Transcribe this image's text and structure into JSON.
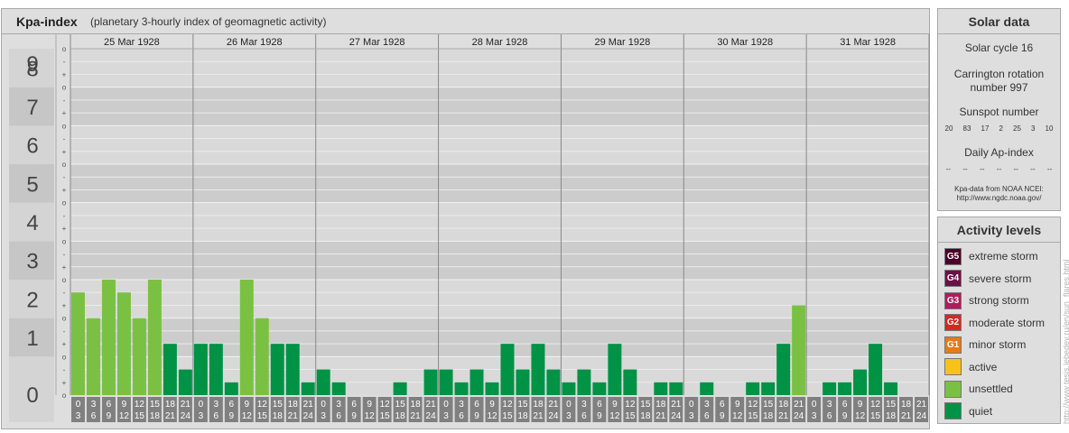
{
  "header": {
    "title": "Kpa-index",
    "subtitle": "(planetary 3-hourly index of geomagnetic activity)"
  },
  "chart_data": {
    "type": "bar",
    "title": "Kpa-index",
    "subtitle": "(planetary 3-hourly index of geomagnetic activity)",
    "ylim": [
      0,
      9
    ],
    "y_ticks": [
      "0",
      "1",
      "2",
      "3",
      "4",
      "5",
      "6",
      "7",
      "8",
      "9"
    ],
    "y_subticks": [
      "o",
      "+",
      "-"
    ],
    "days": [
      "25 Mar 1928",
      "26 Mar 1928",
      "27 Mar 1928",
      "28 Mar 1928",
      "29 Mar 1928",
      "30 Mar 1928",
      "31 Mar 1928"
    ],
    "interval_start_labels": [
      "0",
      "3",
      "6",
      "9",
      "12",
      "15",
      "18",
      "21"
    ],
    "interval_end_labels": [
      "3",
      "6",
      "9",
      "12",
      "15",
      "18",
      "21",
      "24"
    ],
    "values": [
      [
        2.667,
        2.0,
        3.0,
        2.667,
        2.0,
        3.0,
        1.333,
        0.667
      ],
      [
        1.333,
        1.333,
        0.333,
        3.0,
        2.0,
        1.333,
        1.333,
        0.333
      ],
      [
        0.667,
        0.333,
        0.0,
        0.0,
        0.0,
        0.333,
        0.0,
        0.667
      ],
      [
        0.667,
        0.333,
        0.667,
        0.333,
        1.333,
        0.667,
        1.333,
        0.667
      ],
      [
        0.333,
        0.667,
        0.333,
        1.333,
        0.667,
        0.0,
        0.333,
        0.333
      ],
      [
        0.0,
        0.333,
        0.0,
        0.0,
        0.333,
        0.333,
        1.333,
        2.333
      ],
      [
        0.0,
        0.333,
        0.333,
        0.667,
        1.333,
        0.333,
        0.0,
        0.0
      ]
    ],
    "level_colors": {
      "quiet": "#009245",
      "unsettled": "#7ac143",
      "active": "#f7c21c",
      "minor": "#e37b1c",
      "moderate": "#d12a1f",
      "strong": "#b01c5c",
      "severe": "#6d0f46",
      "extreme": "#4a0028"
    },
    "grid": true,
    "legend_placement": "right"
  },
  "solar": {
    "title": "Solar data",
    "cycle": "Solar cycle 16",
    "carrington_line1": "Carrington rotation",
    "carrington_line2": "number 997",
    "sunspot_title": "Sunspot number",
    "sunspot_values": [
      "20",
      "83",
      "17",
      "2",
      "25",
      "3",
      "10"
    ],
    "ap_title": "Daily Ap-index",
    "ap_values": [
      "--",
      "--",
      "--",
      "--",
      "--",
      "--",
      "--"
    ],
    "source_line1": "Kpa-data from NOAA NCEI:",
    "source_line2": "http://www.ngdc.noaa.gov/"
  },
  "activity": {
    "title": "Activity levels",
    "items": [
      {
        "badge": "G5",
        "label": "extreme storm",
        "color": "#4a0028"
      },
      {
        "badge": "G4",
        "label": "severe storm",
        "color": "#6d0f46"
      },
      {
        "badge": "G3",
        "label": "strong storm",
        "color": "#b01c5c"
      },
      {
        "badge": "G2",
        "label": "moderate storm",
        "color": "#d12a1f"
      },
      {
        "badge": "G1",
        "label": "minor storm",
        "color": "#e37b1c"
      },
      {
        "badge": "",
        "label": "active",
        "color": "#f7c21c"
      },
      {
        "badge": "",
        "label": "unsettled",
        "color": "#7ac143"
      },
      {
        "badge": "",
        "label": "quiet",
        "color": "#009245"
      }
    ]
  },
  "watermark": "http://www.tesis.lebedev.ru/en/sun_flares.html"
}
